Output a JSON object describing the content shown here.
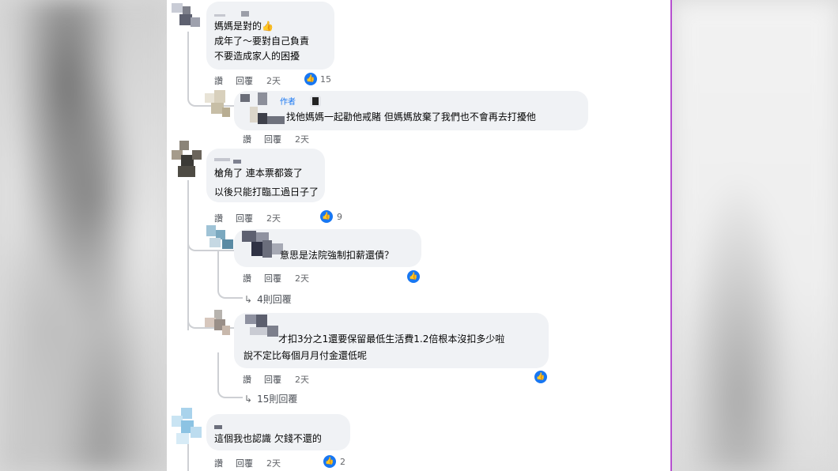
{
  "comments": [
    {
      "lines": [
        "媽媽是對的👍",
        "成年了～要對自己負責",
        "不要造成家人的困擾"
      ],
      "time": "2天",
      "likes": "15"
    },
    {
      "author_tag": "作者",
      "lines": [
        "找他媽媽一起勸他戒賭 但媽媽放棄了我們也不會再去打擾他"
      ],
      "time": "2天"
    },
    {
      "lines": [
        "槍角了 連本票都簽了",
        "以後只能打臨工過日子了"
      ],
      "time": "2天",
      "likes": "9"
    },
    {
      "lines": [
        "意思是法院強制扣薪還債？"
      ],
      "time": "2天",
      "more_replies": "4則回覆"
    },
    {
      "lines": [
        "才扣3分之1還要保留最低生活費1.2倍根本沒扣多少啦",
        "說不定比每個月月付金還低呢"
      ],
      "time": "2天",
      "more_replies": "15則回覆"
    },
    {
      "lines": [
        "這個我也認識 欠錢不還的"
      ],
      "time": "2天",
      "likes": "2"
    }
  ],
  "actions": {
    "like": "讚",
    "reply": "回覆"
  },
  "colors": {
    "accent": "#1877f2",
    "bubble": "#f0f2f5",
    "divider": "#b64fd0"
  }
}
